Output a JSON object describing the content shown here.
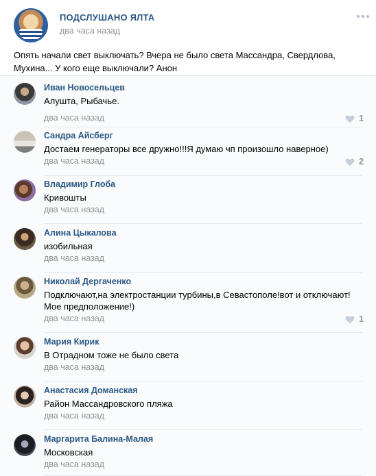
{
  "post": {
    "group_name": "ПОДСЛУШАНО ЯЛТА",
    "time": "два часа назад",
    "text": "Опять начали свет выключать? Вчера не было света Массандра, Свердлова, Мухина... У кого еще выключали? Анон",
    "more_icon": "more-horizontal-icon"
  },
  "comments": [
    {
      "author": "Иван Новосельцев",
      "text": "Алушта, Рыбачье.",
      "time": "два часа назад",
      "likes": "1"
    },
    {
      "author": "Сандра Айсберг",
      "text": "Достаем генераторы все дружно!!!Я думаю чп произошло наверное)",
      "time": "два часа назад",
      "likes": "2"
    },
    {
      "author": "Владимир Глоба",
      "text": "Кривошты",
      "time": "два часа назад",
      "likes": ""
    },
    {
      "author": "Алина Цыкалова",
      "text": "изобильная",
      "time": "два часа назад",
      "likes": ""
    },
    {
      "author": "Николай Дергаченко",
      "text": "Подключают,на электростанции турбины,в Севастополе!вот и отключают! Мое предположение!)",
      "time": "два часа назад",
      "likes": "1"
    },
    {
      "author": "Мария Кирик",
      "text": "В Отрадном тоже не было света",
      "time": "два часа назад",
      "likes": ""
    },
    {
      "author": "Анастасия Доманская",
      "text": "Район Массандровского пляжа",
      "time": "два часа назад",
      "likes": ""
    },
    {
      "author": "Маргарита Балина-Малая",
      "text": "Московская",
      "time": "два часа назад",
      "likes": ""
    }
  ],
  "icons": {
    "like": "heart-icon"
  },
  "colors": {
    "link": "#2a5885",
    "meta": "#939393",
    "divider": "#e7e8ec"
  }
}
